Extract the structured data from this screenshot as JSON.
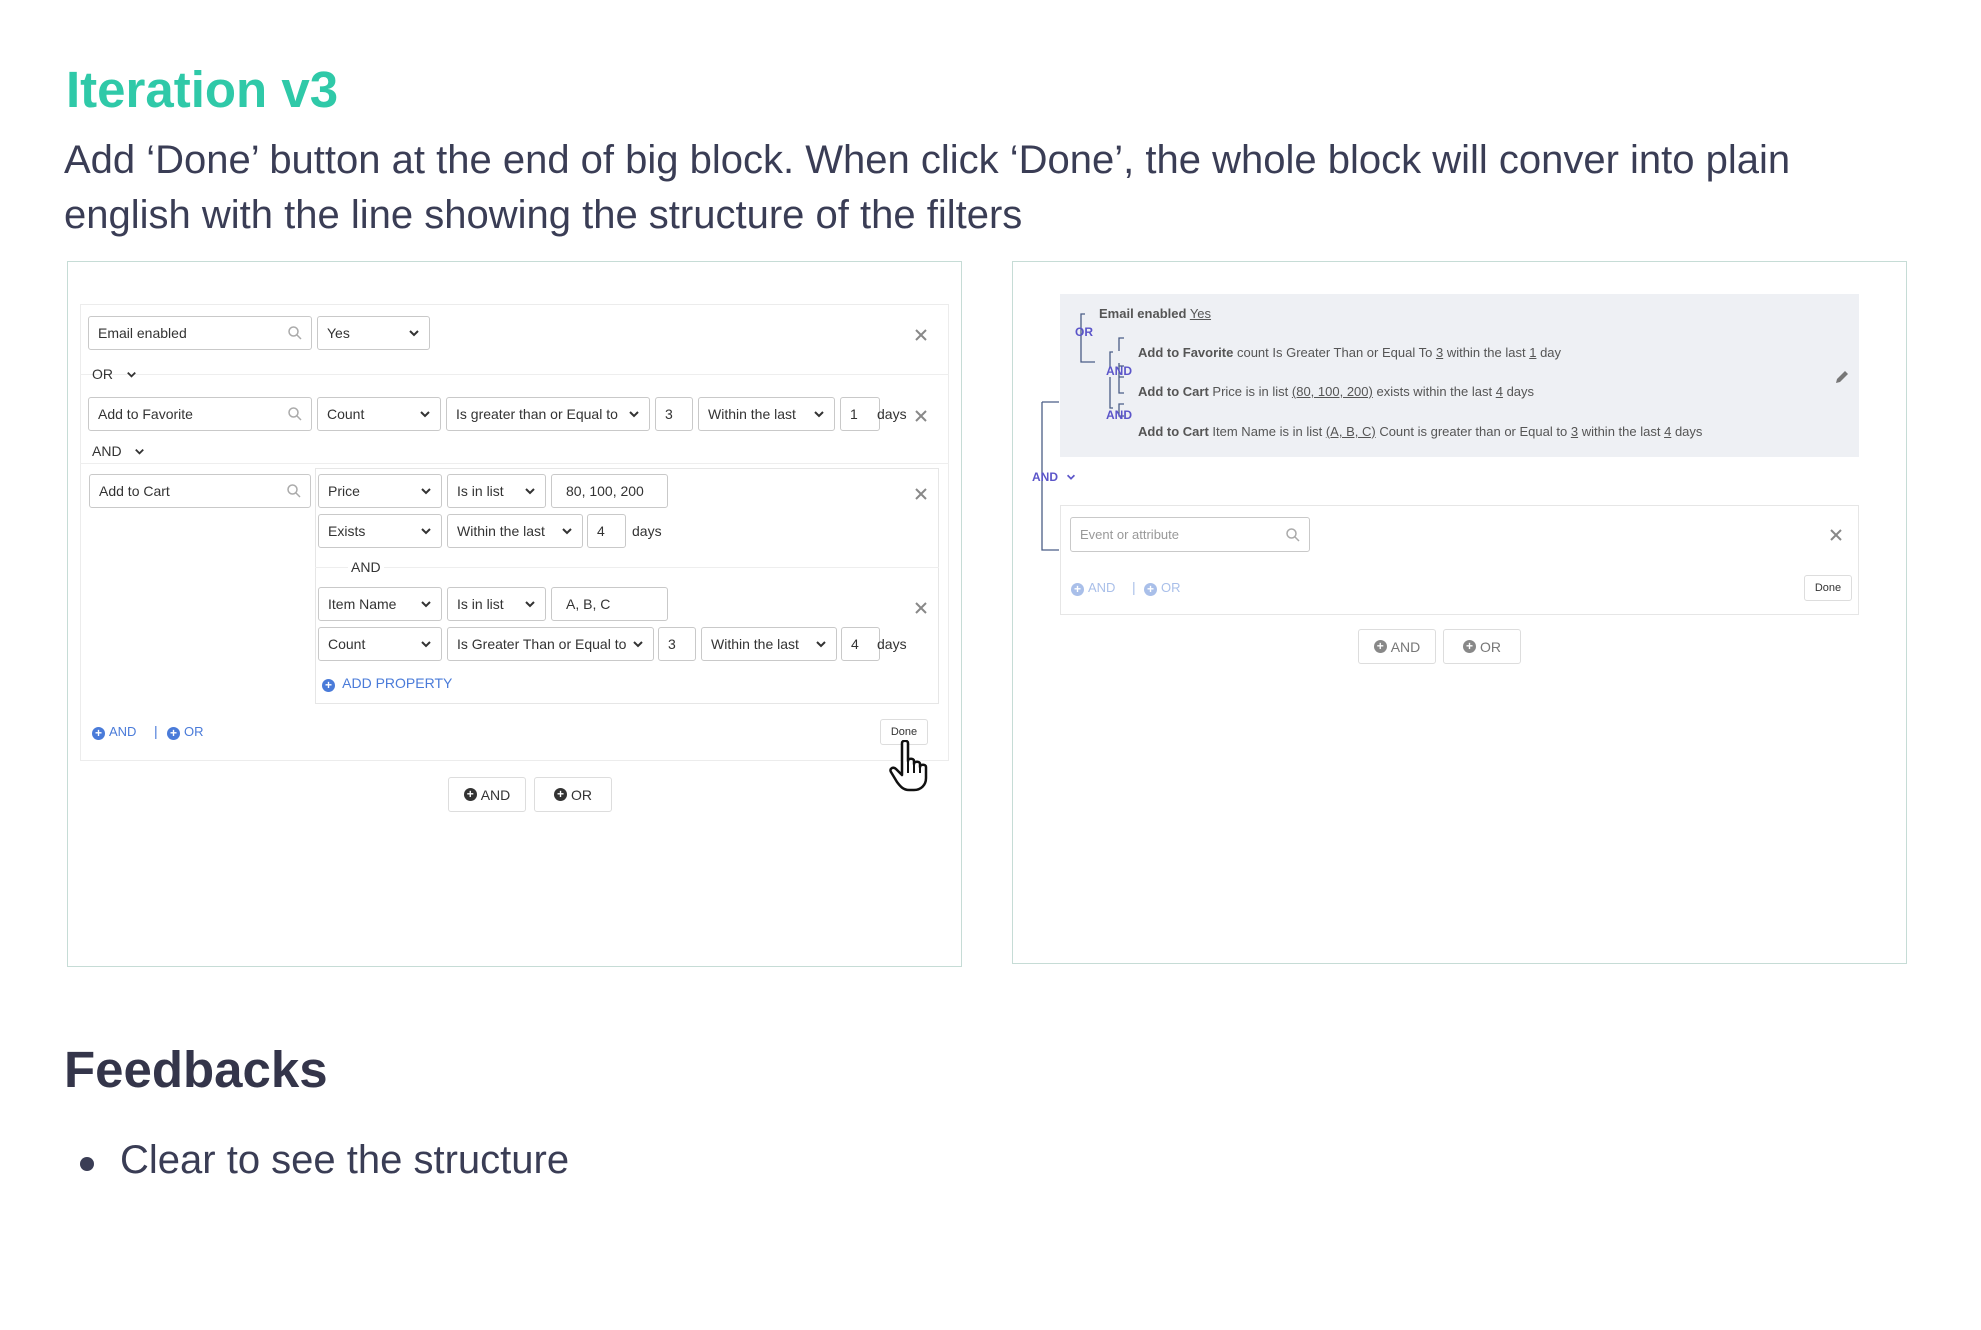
{
  "header": {
    "title": "Iteration v3",
    "description": "Add ‘Done’ button at the end of big block. When click ‘Done’, the whole block will conver into plain english with the line showing the structure of the filters"
  },
  "left_panel": {
    "row1": {
      "event": "Email enabled",
      "value": "Yes"
    },
    "or_label": "OR",
    "row2": {
      "event": "Add to Favorite",
      "metric": "Count",
      "operator": "Is greater than or Equal to",
      "amount": "3",
      "time": "Within the last",
      "period": "1",
      "unit": "days"
    },
    "and_label": "AND",
    "row3": {
      "event": "Add to Cart",
      "p1": {
        "property": "Price",
        "operator": "Is in list",
        "value": "80, 100, 200",
        "metric": "Exists",
        "time": "Within the last",
        "period": "4",
        "unit": "days"
      },
      "and_label": "AND",
      "p2": {
        "property": "Item Name",
        "operator": "Is in list",
        "value": "A, B, C",
        "metric": "Count",
        "comparison": "Is Greater Than or Equal to",
        "amount": "3",
        "time": "Within the last",
        "period": "4",
        "unit": "days"
      },
      "add_property": "ADD PROPERTY"
    },
    "footer": {
      "and": "AND",
      "sep": "|",
      "or": "OR",
      "done": "Done"
    },
    "bottom": {
      "and": "AND",
      "or": "OR"
    }
  },
  "right_panel": {
    "summary": {
      "line1_bold": "Email enabled",
      "line1_value": "Yes",
      "or_label": "OR",
      "line2_bold": "Add to Favorite",
      "line2_a": "count Is Greater Than or Equal To",
      "line2_n": "3",
      "line2_b": "within the last",
      "line2_d": "1",
      "line2_c": "day",
      "and1": "AND",
      "line3_bold": "Add to Cart",
      "line3_a": "Price is in list",
      "line3_list": "(80, 100, 200)",
      "line3_b": "exists within the last",
      "line3_d": "4",
      "line3_c": "days",
      "and2": "AND",
      "line4_bold": "Add to Cart",
      "line4_a": "Item Name is in list",
      "line4_list": "(A, B, C)",
      "line4_b": "Count is greater than or Equal to",
      "line4_n": "3",
      "line4_c": "within the last",
      "line4_d": "4",
      "line4_e": "days"
    },
    "and_label": "AND",
    "new_block": {
      "placeholder": "Event or attribute",
      "and": "AND",
      "sep": "|",
      "or": "OR",
      "done": "Done"
    },
    "bottom": {
      "and": "AND",
      "or": "OR"
    }
  },
  "feedbacks": {
    "title": "Feedbacks",
    "items": [
      "Clear to see the structure"
    ]
  }
}
